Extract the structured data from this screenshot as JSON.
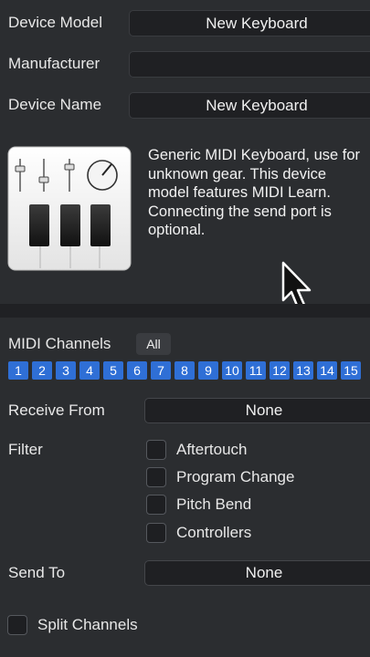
{
  "device": {
    "model_label": "Device Model",
    "model_value": "New Keyboard",
    "manufacturer_label": "Manufacturer",
    "manufacturer_value": "",
    "name_label": "Device Name",
    "name_value": "New Keyboard",
    "description": "Generic MIDI Keyboard, use for\nunknown gear. This device\nmodel features MIDI Learn.\nConnecting the send port is\noptional."
  },
  "midi": {
    "channels_label": "MIDI Channels",
    "all_button": "All",
    "channels": [
      "1",
      "2",
      "3",
      "4",
      "5",
      "6",
      "7",
      "8",
      "9",
      "10",
      "11",
      "12",
      "13",
      "14",
      "15"
    ]
  },
  "receive": {
    "label": "Receive From",
    "value": "None"
  },
  "filter": {
    "label": "Filter",
    "options": [
      {
        "label": "Aftertouch",
        "checked": false
      },
      {
        "label": "Program Change",
        "checked": false
      },
      {
        "label": "Pitch Bend",
        "checked": false
      },
      {
        "label": "Controllers",
        "checked": false
      }
    ]
  },
  "send": {
    "label": "Send To",
    "value": "None"
  },
  "split": {
    "label": "Split Channels",
    "checked": false
  },
  "colors": {
    "background": "#2b2d30",
    "channel_selected": "#2f6fd6",
    "field": "#1f2023"
  }
}
